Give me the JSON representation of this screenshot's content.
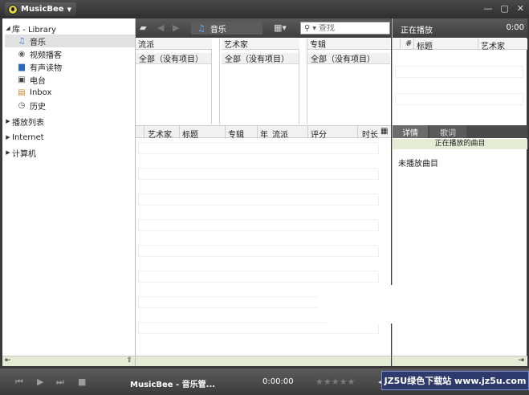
{
  "app": {
    "title": "MusicBee",
    "controls": {
      "minimize": "—",
      "maximize": "▢",
      "close": "✕"
    }
  },
  "sidebar": {
    "library_label": "库 - Library",
    "items": [
      {
        "label": "音乐",
        "icon": "music-note-icon",
        "selected": true
      },
      {
        "label": "视频播客",
        "icon": "video-podcast-icon"
      },
      {
        "label": "有声读物",
        "icon": "audiobook-icon"
      },
      {
        "label": "电台",
        "icon": "radio-icon"
      },
      {
        "label": "Inbox",
        "icon": "inbox-icon"
      },
      {
        "label": "历史",
        "icon": "history-clock-icon"
      }
    ],
    "playlists_label": "播放列表",
    "internet_label": "Internet",
    "computer_label": "计算机"
  },
  "toolbar": {
    "current_view": "音乐",
    "search_placeholder": "查找"
  },
  "filters": {
    "columns": [
      {
        "header": "流派",
        "all_label": "全部（没有项目）"
      },
      {
        "header": "艺术家",
        "all_label": "全部（没有项目）"
      },
      {
        "header": "专辑",
        "all_label": "全部（没有项目）"
      }
    ]
  },
  "tracklist": {
    "headers": [
      "艺术家",
      "标题",
      "专辑",
      "年",
      "流派",
      "评分",
      "时长"
    ]
  },
  "now_playing": {
    "title": "正在播放",
    "time": "0:00",
    "headers": [
      "#",
      "标题",
      "艺术家"
    ],
    "tabs": {
      "details": "详情",
      "lyrics": "歌词"
    },
    "caption": "正在播放的曲目",
    "empty_message": "未播放曲目"
  },
  "player": {
    "now_title": "MusicBee - 音乐管...",
    "time": "0:00:00",
    "rating": "★★★★★"
  },
  "watermark": {
    "text": "JZ5U绿色下载站 www.jz5u.com"
  }
}
